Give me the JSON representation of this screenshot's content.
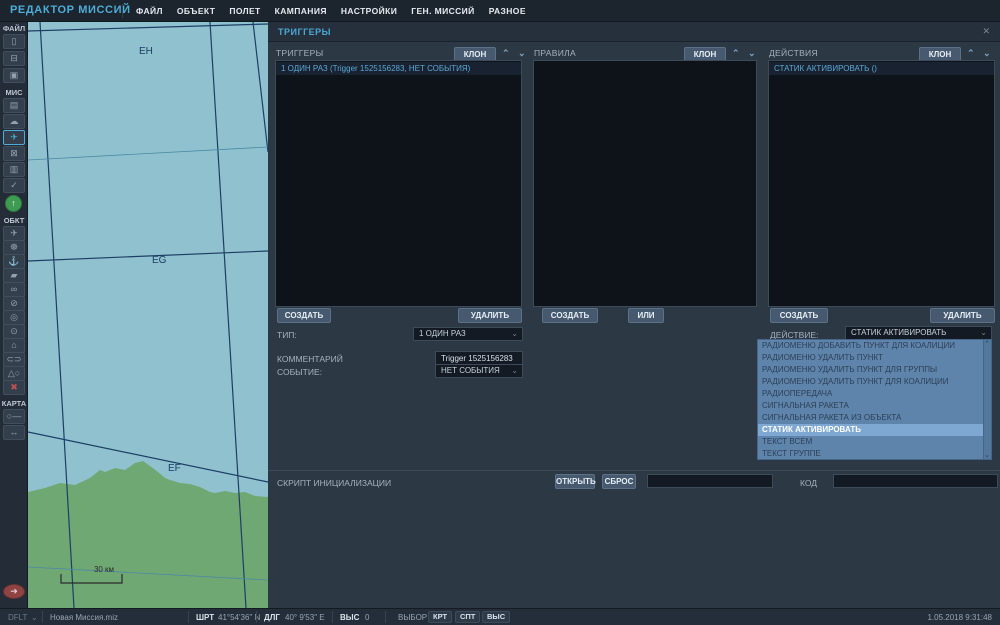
{
  "menu_bar": {
    "title": "РЕДАКТОР МИССИЙ",
    "items": [
      "ФАЙЛ",
      "ОБЪЕКТ",
      "ПОЛЕТ",
      "КАМПАНИЯ",
      "НАСТРОЙКИ",
      "ГЕН. МИССИЙ",
      "РАЗНОЕ"
    ]
  },
  "sidebar": {
    "sections": [
      "ФАЙЛ",
      "МИС",
      "ОБКТ",
      "КАРТА"
    ],
    "icons": {
      "new_file": "▯",
      "open_mission": "⊟",
      "save_mission": "▣",
      "briefing": "▤",
      "weather": "☁",
      "routes": "✈",
      "trigger_zones": "⊠",
      "resources": "▥",
      "check": "✓",
      "fly": "↑",
      "airplane": "✈",
      "helicopter": "☸",
      "ship": "⚓",
      "vehicle": "▰",
      "convoy": "∞",
      "waypoint": "⊘",
      "zone": "◎",
      "target": "⊙",
      "static_object": "⌂",
      "linked": "⊂⊃",
      "shapes": "△○",
      "delete": "✖",
      "ruler": "○—",
      "distance": "↔",
      "exit": "➜"
    }
  },
  "map": {
    "labels": {
      "eh": "EH",
      "eg": "EG",
      "ef": "EF"
    },
    "scale": "30 км",
    "colors": {
      "water": "#8FC2CE",
      "land": "#6FA873",
      "grid": "#1E3E66",
      "grid_thin": "#4C88A8"
    }
  },
  "panel": {
    "title": "ТРИГГЕРЫ",
    "close": "✕",
    "columns": {
      "triggers": {
        "header": "ТРИГГЕРЫ",
        "clone": "КЛОН",
        "item": "1 ОДИН РАЗ (Trigger 1525156283, НЕТ СОБЫТИЯ)",
        "create": "СОЗДАТЬ",
        "delete": "УДАЛИТЬ"
      },
      "rules": {
        "header": "ПРАВИЛА",
        "clone": "КЛОН",
        "create": "СОЗДАТЬ",
        "or": "ИЛИ"
      },
      "actions": {
        "header": "ДЕЙСТВИЯ",
        "clone": "КЛОН",
        "item": "СТАТИК АКТИВИРОВАТЬ ()",
        "create": "СОЗДАТЬ",
        "delete": "УДАЛИТЬ"
      }
    },
    "form": {
      "type_label": "ТИП:",
      "type_value": "1 ОДИН РАЗ",
      "comment_label": "КОММЕНТАРИЙ",
      "comment_value": "Trigger 1525156283",
      "event_label": "СОБЫТИЕ:",
      "event_value": "НЕТ СОБЫТИЯ",
      "action_label": "ДЕЙСТВИЕ:",
      "action_value": "СТАТИК АКТИВИРОВАТЬ"
    },
    "action_dropdown": {
      "selected": "СТАТИК АКТИВИРОВАТЬ",
      "items": [
        "РАДИОМЕНЮ ДОБАВИТЬ ПУНКТ ДЛЯ КОАЛИЦИИ",
        "РАДИОМЕНЮ УДАЛИТЬ ПУНКТ",
        "РАДИОМЕНЮ УДАЛИТЬ ПУНКТ ДЛЯ ГРУППЫ",
        "РАДИОМЕНЮ УДАЛИТЬ ПУНКТ ДЛЯ КОАЛИЦИИ",
        "РАДИОПЕРЕДАЧА",
        "СИГНАЛЬНАЯ РАКЕТА",
        "СИГНАЛЬНАЯ РАКЕТА ИЗ ОБЪЕКТА",
        "СТАТИК АКТИВИРОВАТЬ",
        "ТЕКСТ ВСЕМ",
        "ТЕКСТ ГРУППЕ"
      ]
    },
    "script": {
      "label": "СКРИПТ ИНИЦИАЛИЗАЦИИ",
      "open": "ОТКРЫТЬ",
      "reset": "СБРОС",
      "code_label": "КОД"
    }
  },
  "status_bar": {
    "profile": "DFLT",
    "mission": "Новая Миссия.miz",
    "lat_label": "ШРТ",
    "lat": "41°54'36\" N",
    "lon_label": "ДЛГ",
    "lon": "40° 9'53\" E",
    "alt_label": "ВЫС",
    "alt": "0",
    "select": "ВЫБОР",
    "map_btn": "КРТ",
    "sat_btn": "СПТ",
    "alt_btn": "ВЫС",
    "datetime": "1.05.2018 9:31:48"
  }
}
